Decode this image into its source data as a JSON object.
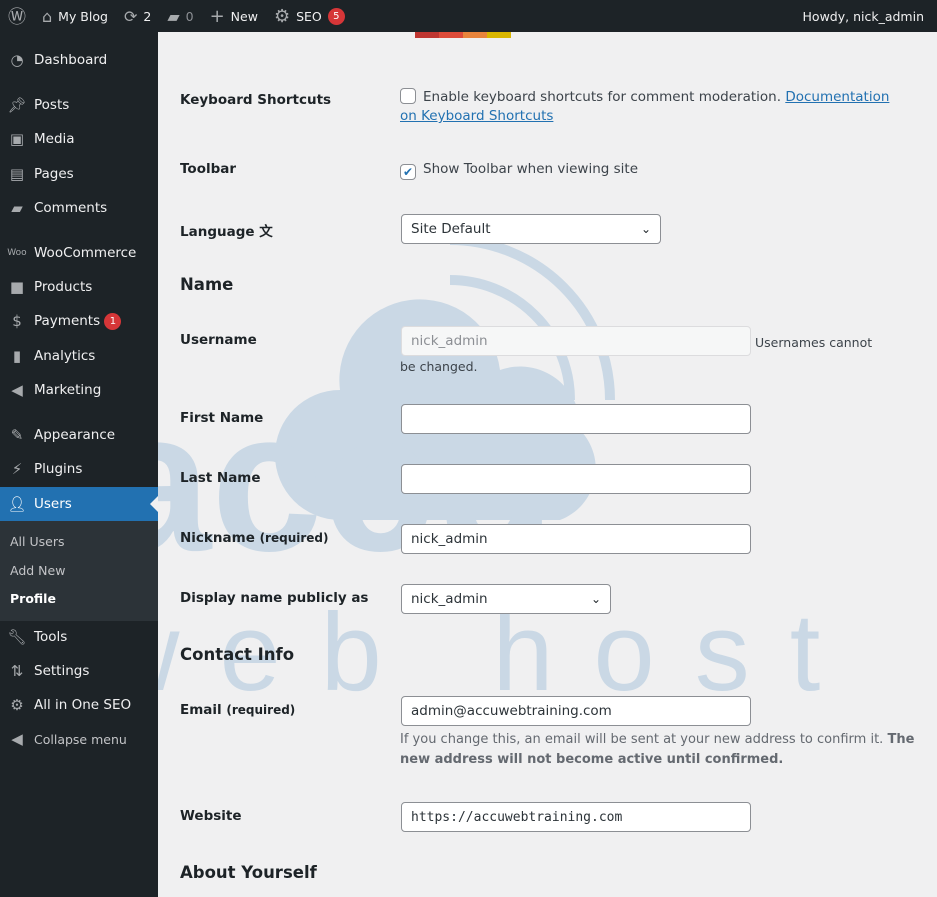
{
  "adminbar": {
    "site": "My Blog",
    "updates": "2",
    "comments": "0",
    "new": "New",
    "seo": "SEO",
    "seo_count": "5",
    "howdy": "Howdy, nick_admin"
  },
  "sidebar": {
    "items": [
      {
        "label": "Dashboard"
      },
      {
        "label": "Posts"
      },
      {
        "label": "Media"
      },
      {
        "label": "Pages"
      },
      {
        "label": "Comments"
      },
      {
        "label": "WooCommerce"
      },
      {
        "label": "Products"
      },
      {
        "label": "Payments",
        "badge": "1"
      },
      {
        "label": "Analytics"
      },
      {
        "label": "Marketing"
      },
      {
        "label": "Appearance"
      },
      {
        "label": "Plugins"
      },
      {
        "label": "Users"
      },
      {
        "label": "Tools"
      },
      {
        "label": "Settings"
      },
      {
        "label": "All in One SEO"
      },
      {
        "label": "Collapse menu"
      }
    ],
    "submenu": [
      "All Users",
      "Add New",
      "Profile"
    ]
  },
  "form": {
    "keyboard_label": "Keyboard Shortcuts",
    "keyboard_text": "Enable keyboard shortcuts for comment moderation.",
    "keyboard_link": "Documentation on Keyboard Shortcuts",
    "keyboard_checked": false,
    "toolbar_label": "Toolbar",
    "toolbar_text": "Show Toolbar when viewing site",
    "toolbar_checked": true,
    "language_label": "Language",
    "language_value": "Site Default",
    "name_heading": "Name",
    "username_label": "Username",
    "username_value": "nick_admin",
    "username_note": "Usernames cannot be changed.",
    "first_name_label": "First Name",
    "first_name_value": "",
    "last_name_label": "Last Name",
    "last_name_value": "",
    "nickname_label": "Nickname",
    "required": "(required)",
    "nickname_value": "nick_admin",
    "display_label": "Display name publicly as",
    "display_value": "nick_admin",
    "contact_heading": "Contact Info",
    "email_label": "Email",
    "email_value": "admin@accuwebtraining.com",
    "email_note": "If you change this, an email will be sent at your new address to confirm it.",
    "email_note_bold": "The new address will not become active until confirmed.",
    "website_label": "Website",
    "website_value": "https://accuwebtraining.com",
    "about_heading": "About Yourself"
  },
  "watermark": "accu web hosting",
  "colors": {
    "accent": "#2271b1",
    "sidebar": "#1d2327",
    "badge": "#d63638"
  }
}
